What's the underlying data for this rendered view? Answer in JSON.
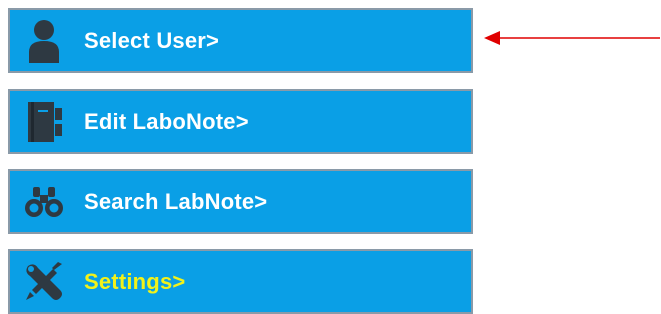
{
  "menu": {
    "items": [
      {
        "label": "Select User>",
        "icon": "user-icon"
      },
      {
        "label": "Edit LaboNote>",
        "icon": "notebook-icon"
      },
      {
        "label": "Search LabNote>",
        "icon": "binoculars-icon"
      },
      {
        "label": "Settings>",
        "icon": "tools-icon"
      }
    ]
  },
  "colors": {
    "button_bg": "#0a9fe6",
    "button_border": "#8a9aa8",
    "label_text": "#ffffff",
    "settings_label_text": "#f2f21a",
    "icon_dark": "#2e3942",
    "arrow": "#e00000"
  },
  "annotation": {
    "arrow_target": "Select User>"
  }
}
